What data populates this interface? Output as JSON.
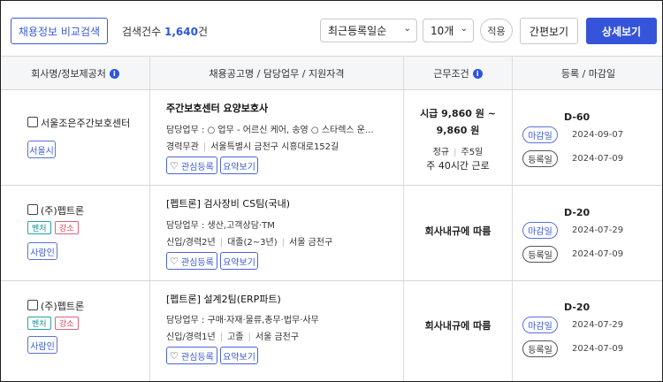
{
  "toolbar": {
    "compare_label": "채용정보 비교검색",
    "count_label": "검색건수 ",
    "count_value": "1,640",
    "count_unit": "건",
    "sort_value": "최근등록일순",
    "per_page_value": "10개",
    "apply_label": "적용",
    "simple_view_label": "간편보기",
    "detail_view_label": "상세보기"
  },
  "headers": {
    "company": "회사명/정보제공처",
    "job": "채용공고명 / 담당업무 / 지원자격",
    "conditions": "근무조건",
    "dates": "등록 / 마감일",
    "info_glyph": "i"
  },
  "common": {
    "fav_label": "관심등록",
    "summary_label": "요약보기",
    "deadline_label": "마감일",
    "register_label": "등록일"
  },
  "rows": [
    {
      "company": "서울조은주간보호센터",
      "loc_tag": "서울시",
      "title": "주간보호센터 요양보호사",
      "duty": "담당업무 : ○ 업무 - 어르신 케어, 송영 ○ 스타렉스 운...",
      "qual_1": "경력무관",
      "qual_2": "서울특별시 금천구 시흥대로152길",
      "cond_1": "시급 9,860 원 ~",
      "cond_2": "9,860 원",
      "cond_3a": "정규",
      "cond_3b": "주5일",
      "cond_4": "주 40시간 근로",
      "dday": "D-60",
      "deadline": "2024-09-07",
      "registered": "2024-07-09"
    },
    {
      "company": "(주)펩트론",
      "tag_1": "벤처",
      "tag_2": "강소",
      "loc_tag": "사람인",
      "title": "[펩트론] 검사장비 CS팀(국내)",
      "duty": "담당업무 : 생산,고객상담·TM",
      "qual_1": "신입/경력2년",
      "qual_2": "대졸(2~3년)",
      "qual_3": "서울 금천구",
      "cond": "회사내규에 따름",
      "dday": "D-20",
      "deadline": "2024-07-29",
      "registered": "2024-07-09"
    },
    {
      "company": "(주)펩트론",
      "tag_1": "벤처",
      "tag_2": "강소",
      "loc_tag": "사람인",
      "title": "[펩트론] 설계2팀(ERP파트)",
      "duty": "담당업무 : 구매·자재·물류,총무·법무·사무",
      "qual_1": "신입/경력1년",
      "qual_2": "고졸",
      "qual_3": "서울 금천구",
      "cond": "회사내규에 따름",
      "dday": "D-20",
      "deadline": "2024-07-29",
      "registered": "2024-07-09"
    }
  ]
}
